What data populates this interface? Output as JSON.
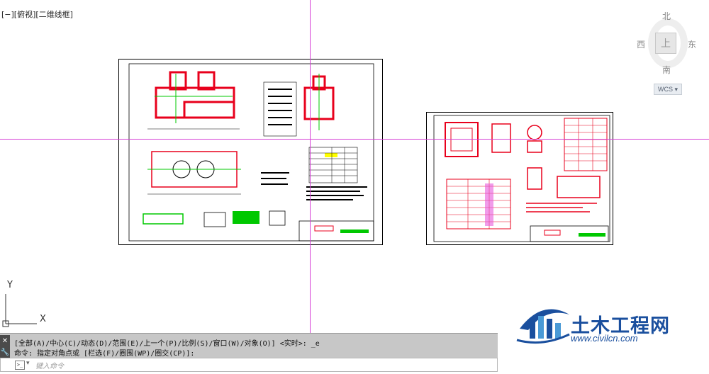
{
  "viewport": {
    "label": "[−][俯视][二维线框]"
  },
  "viewcube": {
    "north": "北",
    "south": "南",
    "east": "东",
    "west": "西",
    "face": "上",
    "wcs": "WCS ▾"
  },
  "ucs": {
    "x_label": "X",
    "y_label": "Y"
  },
  "command": {
    "history_line_1": "[全部(A)/中心(C)/动态(D)/范围(E)/上一个(P)/比例(S)/窗口(W)/对象(O)] <实时>: _e",
    "history_line_2": "命令: 指定对角点或 [栏选(F)/圈围(WP)/圈交(CP)]:",
    "placeholder": "键入命令",
    "prompt_icon": ">_",
    "arrow": "▾"
  },
  "watermark": {
    "name": "土木工程网",
    "url": "www.civilcn.com"
  },
  "colors": {
    "crosshair": "#d63fd6",
    "drawing_red": "#e8001c",
    "drawing_green": "#00c800",
    "watermark_blue": "#1a4f9e"
  }
}
